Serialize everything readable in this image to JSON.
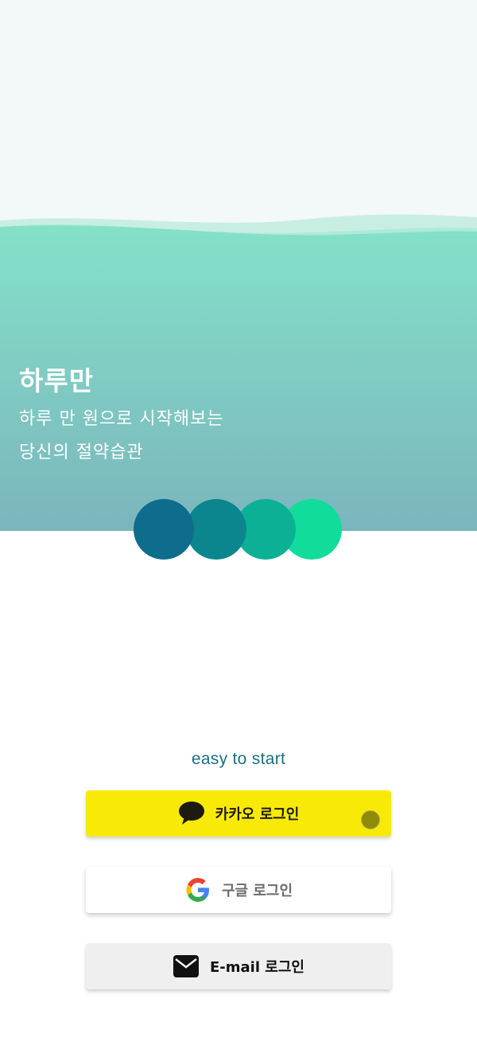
{
  "app": {
    "title": "하루만",
    "subtitle_line1": "하루 만 원으로 시작해보는",
    "subtitle_line2": "당신의 절약습관"
  },
  "logo": {
    "circle_colors": [
      "#0e6c8c",
      "#0b858e",
      "#0cb195",
      "#12dc9c"
    ]
  },
  "tagline": "easy to start",
  "buttons": {
    "kakao": {
      "label": "카카오 로그인",
      "icon": "speech-bubble-icon",
      "color": "#f8ea06"
    },
    "google": {
      "label": "구글 로그인",
      "icon": "google-g-icon",
      "color": "#ffffff"
    },
    "email": {
      "label": "E-mail 로그인",
      "icon": "mail-icon",
      "color": "#efefef"
    }
  },
  "colors": {
    "hero_top": "#84e1c8",
    "hero_bottom": "#7bb5bd",
    "tagline": "#1c6e84"
  }
}
